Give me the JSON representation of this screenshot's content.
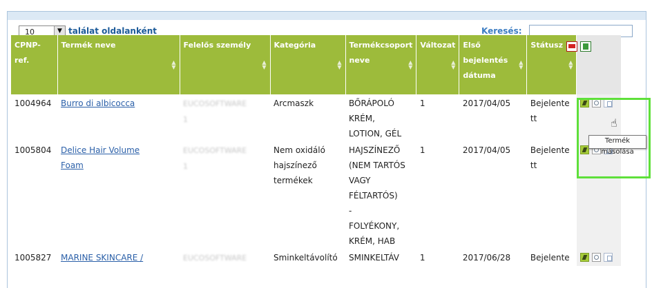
{
  "toolbar": {
    "page_size": "10",
    "per_page_label": "találat oldalanként",
    "search_label": "Keresés:",
    "search_value": ""
  },
  "table": {
    "headers": {
      "cpnp": "CPNP-ref.",
      "name": "Termék neve",
      "person": "Felelős személy",
      "category": "Kategória",
      "group": "Termékcsoport neve",
      "version": "Változat",
      "first_date": "Első bejelentés dátuma",
      "status": "Státusz"
    },
    "rows": [
      {
        "cpnp": "1004964",
        "name_lines": [
          "Burro di albicocca"
        ],
        "person_lines": [
          "EUCOSOFTWARE",
          "1"
        ],
        "category_lines": [
          "Arcmaszk"
        ],
        "group_lines": [
          "BŐRÁPOLÓ",
          "KRÉM,",
          "LOTION, GÉL"
        ],
        "version": "1",
        "date": "2017/04/05",
        "status_lines": [
          "Bejelente",
          "tt"
        ]
      },
      {
        "cpnp": "1005804",
        "name_lines": [
          "Delice Hair Volume",
          "Foam"
        ],
        "person_lines": [
          "EUCOSOFTWARE",
          "1"
        ],
        "category_lines": [
          "Nem oxidáló",
          "hajszínező",
          "termékek"
        ],
        "group_lines": [
          "HAJSZÍNEZŐ",
          "(NEM TARTÓS",
          "VAGY",
          "FÉLTARTÓS)",
          "-",
          "FOLYÉKONY,",
          "KRÉM, HAB"
        ],
        "version": "1",
        "date": "2017/04/05",
        "status_lines": [
          "Bejelente",
          "tt"
        ]
      },
      {
        "cpnp": "1005827",
        "name_lines": [
          "MARINE SKINCARE /"
        ],
        "person_lines": [
          "EUCOSOFTWARE"
        ],
        "category_lines": [
          "Sminkeltávolító"
        ],
        "group_lines": [
          "SMINKELTÁV"
        ],
        "version": "1",
        "date": "2017/06/28",
        "status_lines": [
          "Bejelente"
        ]
      }
    ]
  },
  "tooltip": "Termék másolása",
  "colors": {
    "header_green": "#9dbb3b",
    "link_blue": "#2a5fa8",
    "highlight_green": "#5ee03a"
  },
  "icons": [
    "pdf-export-icon",
    "excel-export-icon",
    "edit-icon",
    "view-icon",
    "copy-icon",
    "hand-cursor-icon"
  ]
}
